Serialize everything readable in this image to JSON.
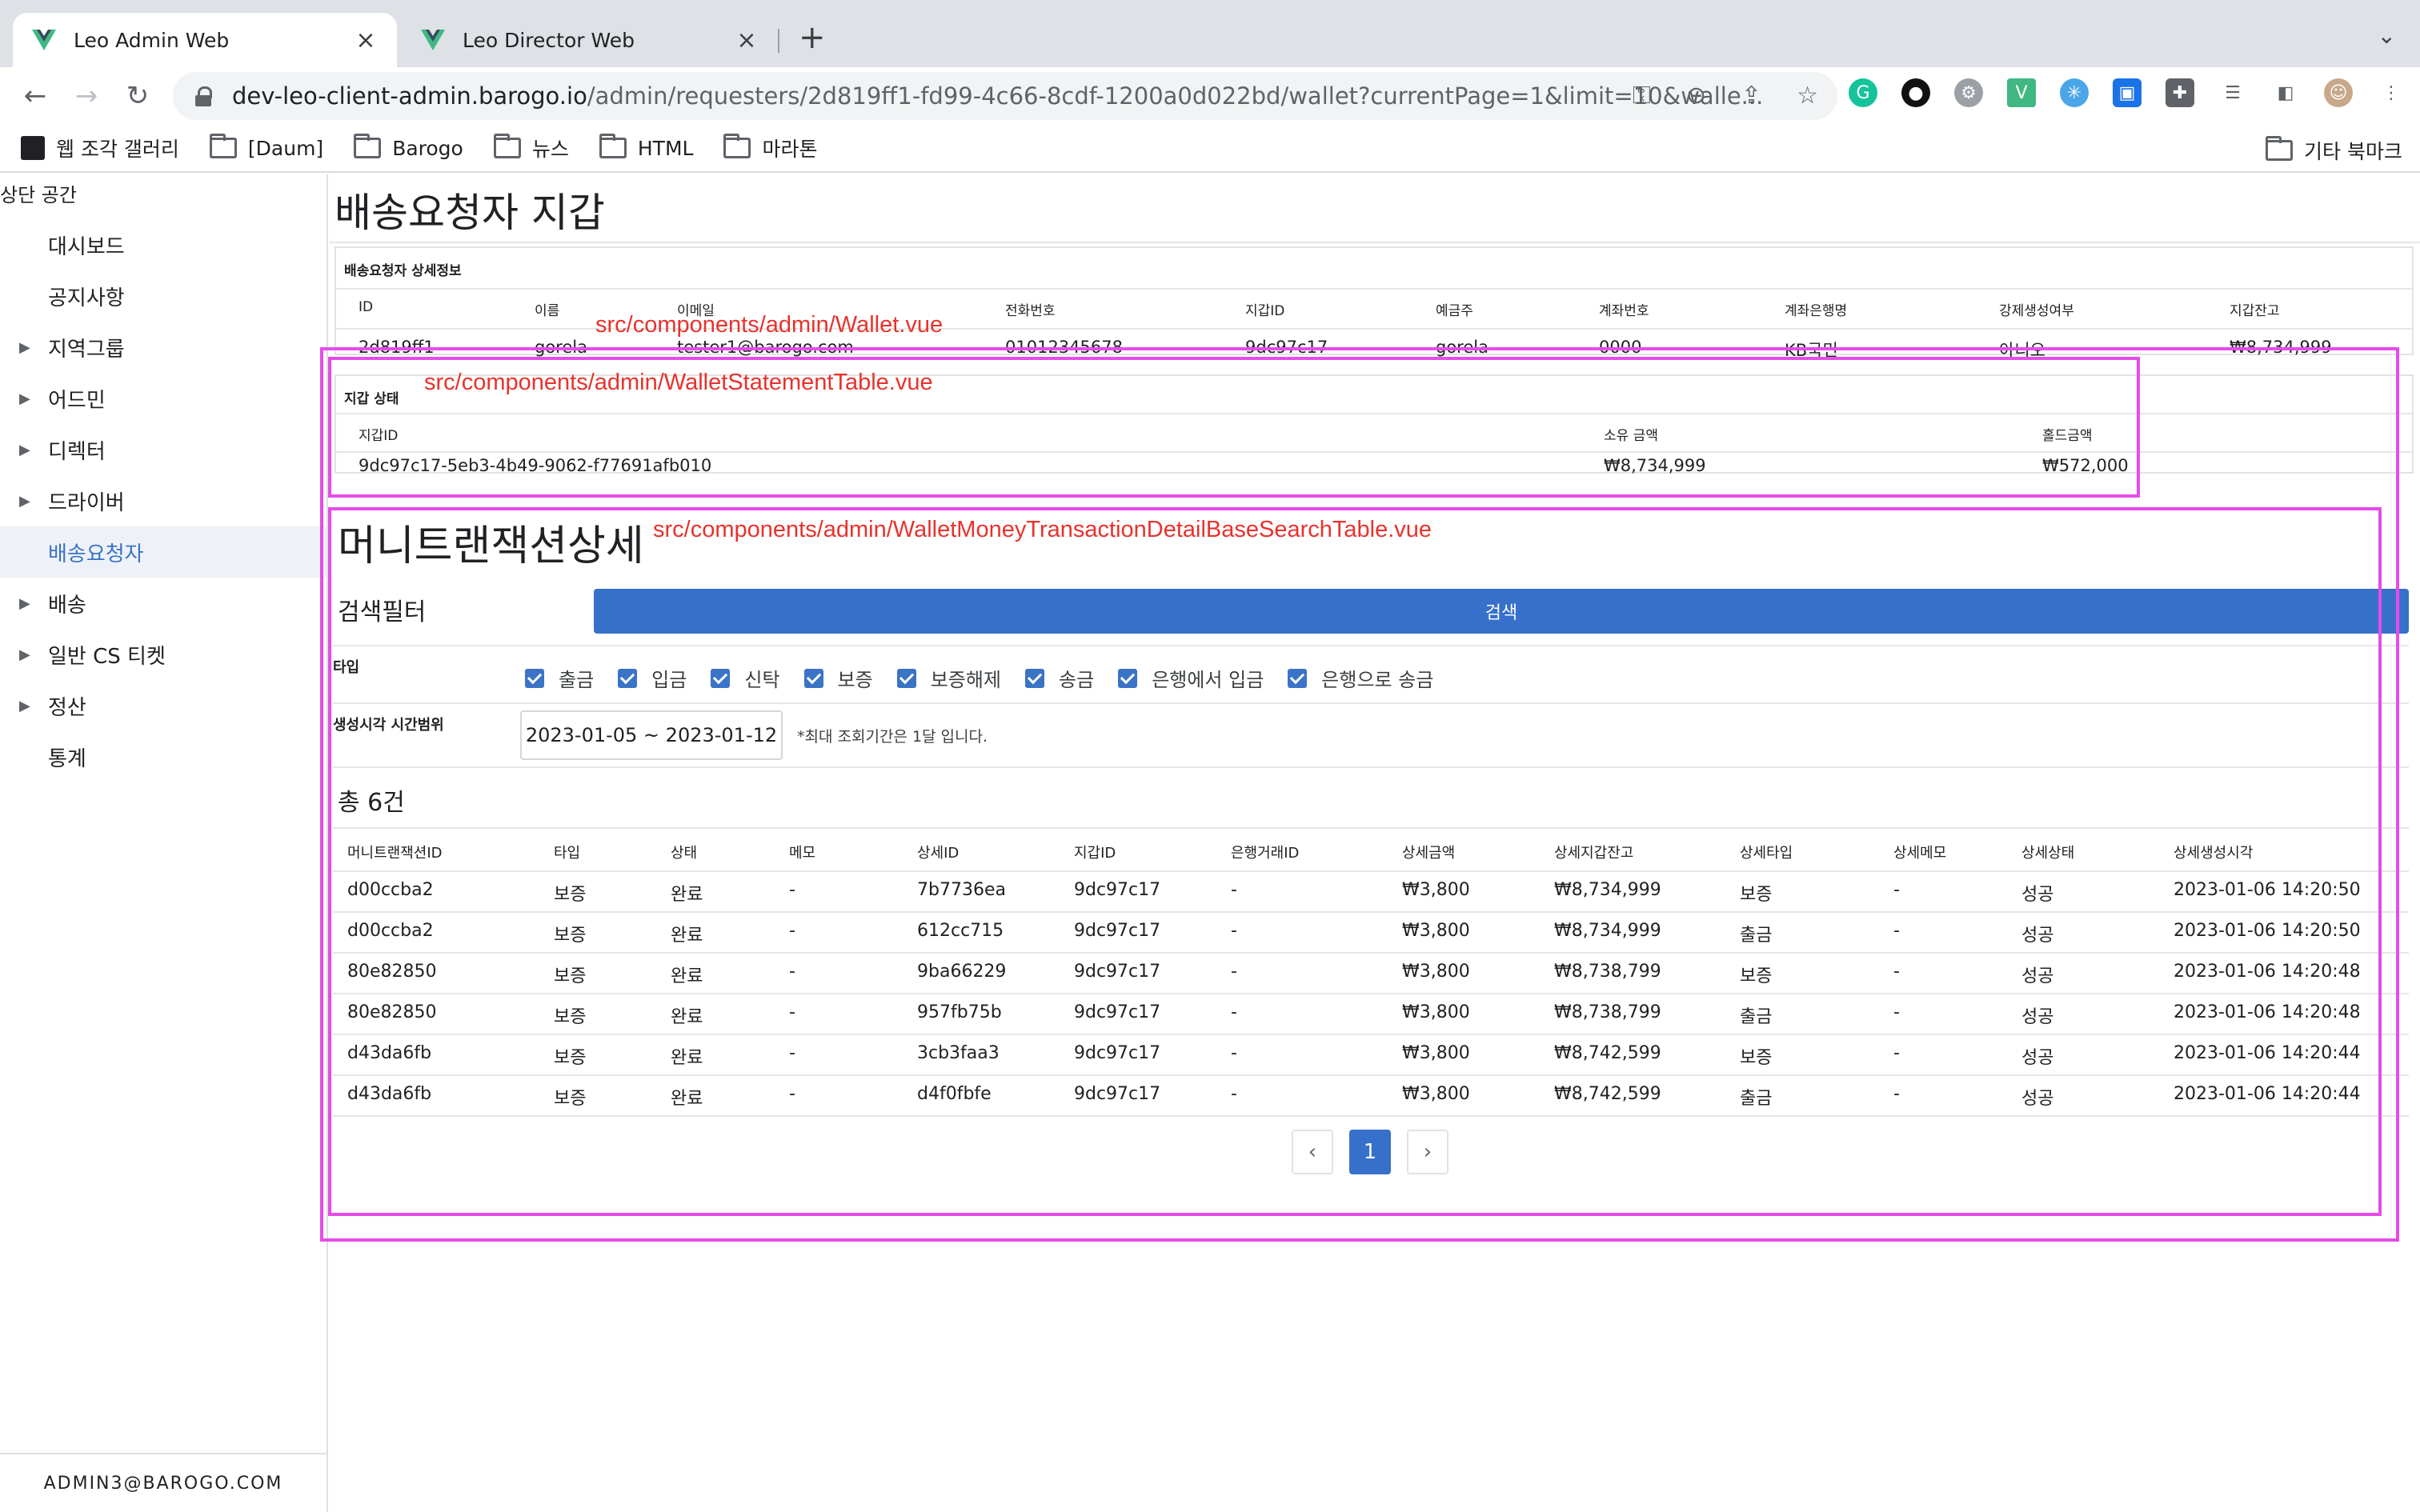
{
  "browser": {
    "tabs": [
      {
        "title": "Leo Admin Web",
        "active": true
      },
      {
        "title": "Leo Director Web",
        "active": false
      }
    ],
    "url_host": "dev-leo-client-admin.barogo.io",
    "url_path": "/admin/requesters/2d819ff1-fd99-4c66-8cdf-1200a0d022bd/wallet?currentPage=1&limit=10&walle...",
    "bookmarks": [
      "웹 조각 갤러리",
      "[Daum]",
      "Barogo",
      "뉴스",
      "HTML",
      "마라톤"
    ],
    "other_bookmarks": "기타 북마크"
  },
  "sidebar": {
    "title": "상단 공간",
    "items": [
      {
        "label": "대시보드",
        "expandable": false,
        "active": false
      },
      {
        "label": "공지사항",
        "expandable": false,
        "active": false
      },
      {
        "label": "지역그룹",
        "expandable": true,
        "active": false
      },
      {
        "label": "어드민",
        "expandable": true,
        "active": false
      },
      {
        "label": "디렉터",
        "expandable": true,
        "active": false
      },
      {
        "label": "드라이버",
        "expandable": true,
        "active": false
      },
      {
        "label": "배송요청자",
        "expandable": false,
        "active": true
      },
      {
        "label": "배송",
        "expandable": true,
        "active": false
      },
      {
        "label": "일반 CS 티켓",
        "expandable": true,
        "active": false
      },
      {
        "label": "정산",
        "expandable": true,
        "active": false
      },
      {
        "label": "통계",
        "expandable": false,
        "active": false
      }
    ],
    "footer_user": "ADMIN3@BAROGO.COM"
  },
  "page": {
    "title": "배송요청자 지갑"
  },
  "requester_detail": {
    "caption": "배송요청자 상세정보",
    "headers": [
      "ID",
      "이름",
      "이메일",
      "전화번호",
      "지갑ID",
      "예금주",
      "계좌번호",
      "계좌은행명",
      "강제생성여부",
      "지갑잔고"
    ],
    "row": [
      "2d819ff1",
      "gorela",
      "tester1@barogo.com",
      "01012345678",
      "9dc97c17",
      "gorela",
      "0000",
      "KB국민",
      "아니오",
      "₩8,734,999"
    ]
  },
  "wallet_status": {
    "caption": "지갑 상태",
    "headers": [
      "지갑ID",
      "소유 금액",
      "홀드금액"
    ],
    "row": [
      "9dc97c17-5eb3-4b49-9062-f77691afb010",
      "₩8,734,999",
      "₩572,000"
    ]
  },
  "annotations": {
    "wallet": "src/components/admin/Wallet.vue",
    "statement_table": "src/components/admin/WalletStatementTable.vue",
    "transaction_table": "src/components/admin/WalletMoneyTransactionDetailBaseSearchTable.vue"
  },
  "transactions": {
    "title": "머니트랜잭션상세",
    "filter_title": "검색필터",
    "search_label": "검색",
    "type_label": "타입",
    "types": [
      "출금",
      "입금",
      "신탁",
      "보증",
      "보증해제",
      "송금",
      "은행에서 입금",
      "은행으로 송금"
    ],
    "time_range_label": "생성시각 시간범위",
    "date_range": "2023-01-05 ~ 2023-01-12",
    "date_note": "*최대 조회기간은 1달 입니다.",
    "total": "총 6건",
    "headers": [
      "머니트랜잭션ID",
      "타입",
      "상태",
      "메모",
      "상세ID",
      "지갑ID",
      "은행거래ID",
      "상세금액",
      "상세지갑잔고",
      "상세타입",
      "상세메모",
      "상세상태",
      "상세생성시각"
    ],
    "rows": [
      [
        "d00ccba2",
        "보증",
        "완료",
        "-",
        "7b7736ea",
        "9dc97c17",
        "-",
        "₩3,800",
        "₩8,734,999",
        "보증",
        "-",
        "성공",
        "2023-01-06 14:20:50"
      ],
      [
        "d00ccba2",
        "보증",
        "완료",
        "-",
        "612cc715",
        "9dc97c17",
        "-",
        "₩3,800",
        "₩8,734,999",
        "출금",
        "-",
        "성공",
        "2023-01-06 14:20:50"
      ],
      [
        "80e82850",
        "보증",
        "완료",
        "-",
        "9ba66229",
        "9dc97c17",
        "-",
        "₩3,800",
        "₩8,738,799",
        "보증",
        "-",
        "성공",
        "2023-01-06 14:20:48"
      ],
      [
        "80e82850",
        "보증",
        "완료",
        "-",
        "957fb75b",
        "9dc97c17",
        "-",
        "₩3,800",
        "₩8,738,799",
        "출금",
        "-",
        "성공",
        "2023-01-06 14:20:48"
      ],
      [
        "d43da6fb",
        "보증",
        "완료",
        "-",
        "3cb3faa3",
        "9dc97c17",
        "-",
        "₩3,800",
        "₩8,742,599",
        "보증",
        "-",
        "성공",
        "2023-01-06 14:20:44"
      ],
      [
        "d43da6fb",
        "보증",
        "완료",
        "-",
        "d4f0fbfe",
        "9dc97c17",
        "-",
        "₩3,800",
        "₩8,742,599",
        "출금",
        "-",
        "성공",
        "2023-01-06 14:20:44"
      ]
    ],
    "pagination": {
      "current_page": "1",
      "prev": "‹",
      "next": "›"
    }
  },
  "colors": {
    "accent": "#3770cb",
    "annotation_border": "#e44ce9",
    "annotation_text": "#e8322d"
  }
}
